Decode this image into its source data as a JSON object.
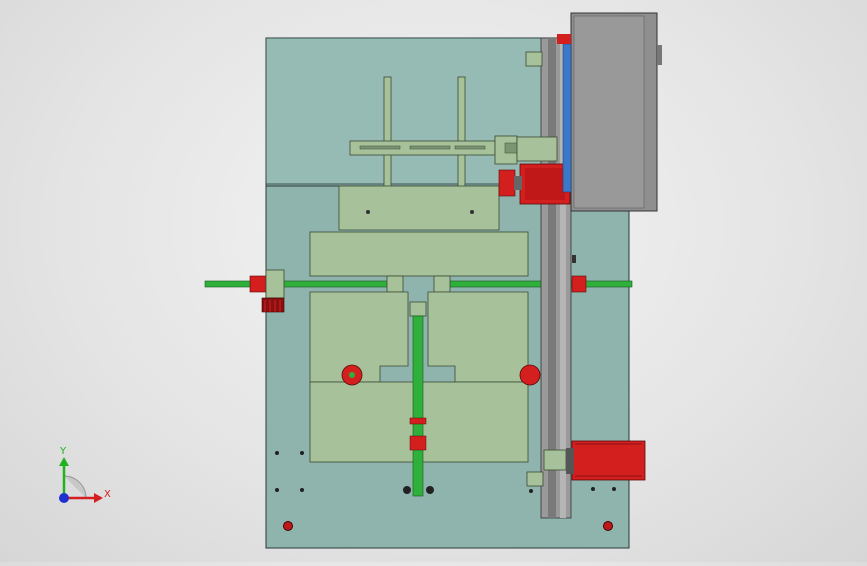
{
  "viewport": {
    "background": "#e6e6e6",
    "view": "front"
  },
  "colors": {
    "plate": "#8fb3ad",
    "plate_edge": "#2a3a38",
    "part_green": "#a7c19a",
    "part_edge": "#3a4a32",
    "shaft_green": "#2fb03a",
    "motor_red": "#d41f1f",
    "motor_dark": "#8a1010",
    "rail_gray": "#9a9a9a",
    "box_gray": "#8f8f8f",
    "blue_strip": "#3a78c9"
  },
  "triad": {
    "x_label": "X",
    "y_label": "Y",
    "x_color": "#d42020",
    "y_color": "#20b020",
    "z_color": "#2030d0"
  }
}
